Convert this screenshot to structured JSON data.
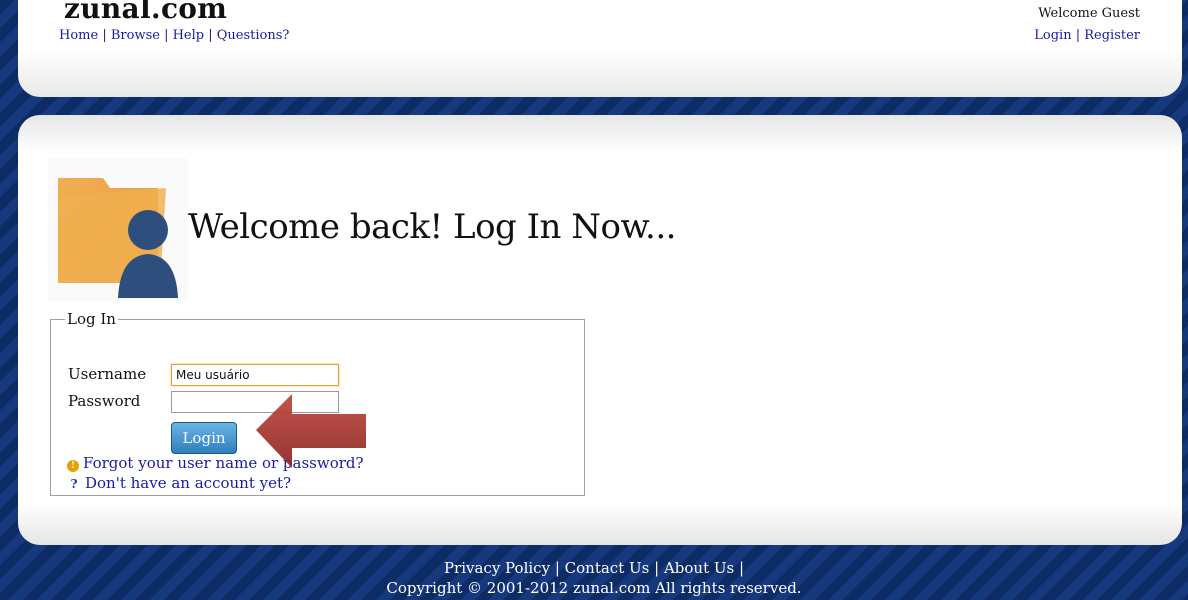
{
  "site": {
    "logo": "zunal.com",
    "nav": [
      "Home",
      "Browse",
      "Help",
      "Questions?"
    ],
    "welcome": "Welcome Guest",
    "auth_links": [
      "Login",
      "Register"
    ]
  },
  "main": {
    "title": "Welcome back! Log In Now...",
    "form": {
      "legend": "Log In",
      "username_label": "Username",
      "username_value": "Meu usuário",
      "password_label": "Password",
      "password_value": "",
      "login_button": "Login",
      "forgot_link": "Forgot your user name or password?",
      "signup_link": "Don't have an account yet?"
    }
  },
  "footer": {
    "links": [
      "Privacy Policy",
      "Contact Us",
      "About Us"
    ],
    "copyright": "Copyright © 2001-2012 zunal.com All rights reserved."
  },
  "colors": {
    "background_stripes": "#0e2f6b",
    "link": "#1a1aa6",
    "button": "#2f7fbd",
    "arrow": "#a8312c"
  },
  "icons": {
    "hero": "folder-user-icon",
    "forgot": "warning-icon",
    "signup": "question-icon",
    "pointer": "arrow-left-icon"
  }
}
